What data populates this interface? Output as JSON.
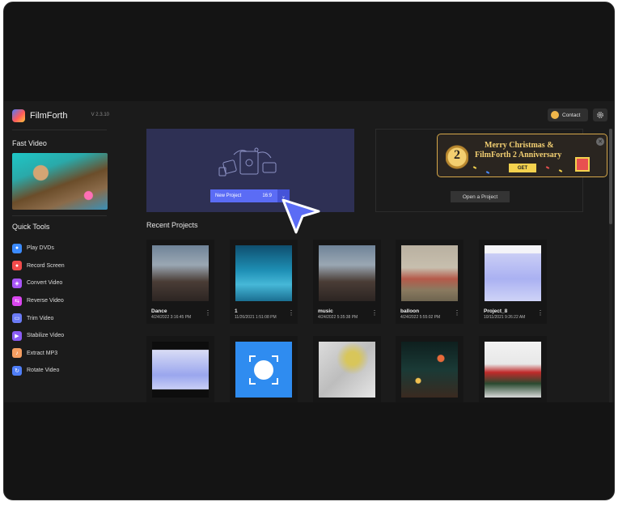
{
  "app": {
    "name": "FilmForth",
    "version": "V 2.3.10"
  },
  "sidebar": {
    "fast_video_title": "Fast Video",
    "quick_tools_title": "Quick Tools",
    "tools": [
      {
        "label": "Play DVDs",
        "icon": "disc-icon",
        "color": "#3b8bff"
      },
      {
        "label": "Record Screen",
        "icon": "record-icon",
        "color": "#f24b4b"
      },
      {
        "label": "Convert Video",
        "icon": "convert-icon",
        "color": "#a855f7"
      },
      {
        "label": "Reverse Video",
        "icon": "reverse-icon",
        "color": "#d946ef"
      },
      {
        "label": "Trim Video",
        "icon": "trim-icon",
        "color": "#6b7bf5"
      },
      {
        "label": "Stabilize Video",
        "icon": "stabilize-icon",
        "color": "#8b5cf6"
      },
      {
        "label": "Extract MP3",
        "icon": "music-icon",
        "color": "#f59e62"
      },
      {
        "label": "Rotate Video",
        "icon": "rotate-icon",
        "color": "#4f7ef7"
      }
    ]
  },
  "header": {
    "contact_label": "Contact"
  },
  "new_project": {
    "label": "New Project",
    "ratio": "16:9"
  },
  "open_project": {
    "label": "Open a Project"
  },
  "promo": {
    "badge": "2",
    "line1": "Merry Christmas &",
    "line2": "FilmForth 2 Anniversary",
    "cta": "GET"
  },
  "recent": {
    "title": "Recent Projects",
    "projects": [
      {
        "name": "Dance",
        "date": "4/24/2022 3:16:45 PM"
      },
      {
        "name": "1",
        "date": "11/26/2021 1:51:08 PM"
      },
      {
        "name": "music",
        "date": "4/24/2022 5:35:38 PM"
      },
      {
        "name": "balloon",
        "date": "4/24/2022 5:55:02 PM"
      },
      {
        "name": "Project_8",
        "date": "10/11/2021 9:26:22 AM"
      },
      {
        "name": "",
        "date": ""
      },
      {
        "name": "",
        "date": ""
      },
      {
        "name": "",
        "date": ""
      },
      {
        "name": "",
        "date": ""
      },
      {
        "name": "",
        "date": ""
      }
    ]
  }
}
